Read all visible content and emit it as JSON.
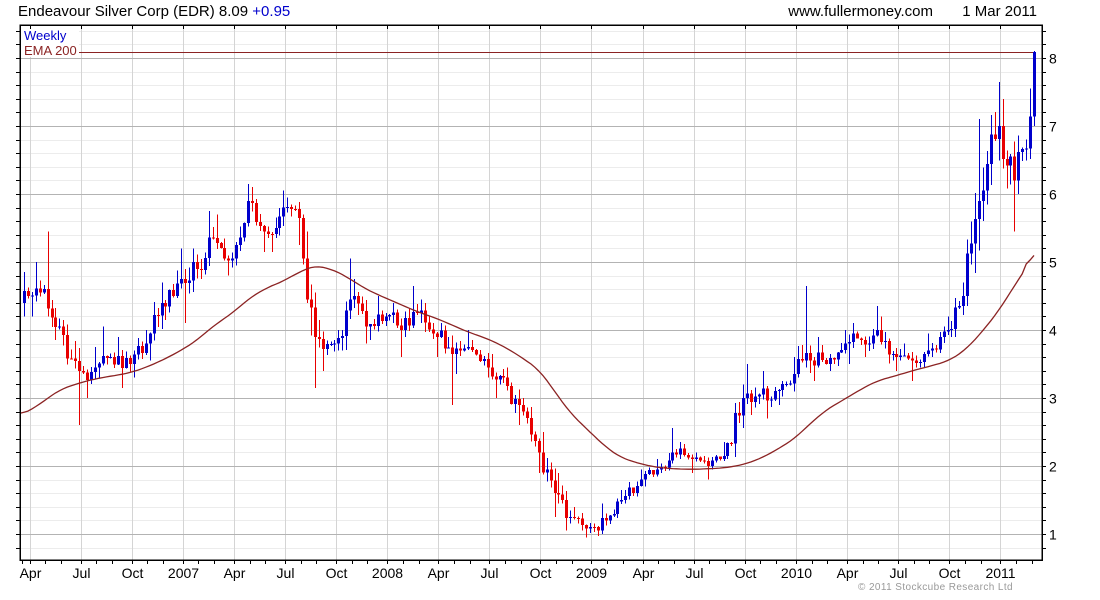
{
  "header": {
    "title": "Endeavour Silver Corp (EDR)",
    "last_price": "8.09",
    "change": "+0.95",
    "source": "www.fullermoney.com",
    "date": "1 Mar 2011"
  },
  "legend": {
    "period": "Weekly",
    "overlay": "EMA 200"
  },
  "footer": {
    "copyright": "© 2011 Stockcube Research Ltd"
  },
  "colors": {
    "up": "#0000cc",
    "down": "#e80000",
    "ema": "#8b2323",
    "last_price_line": "#8b2323",
    "grid_major": "#b3b3b3",
    "grid_minor": "#ececec",
    "grid_vertical": "#d4d4d4",
    "axis": "#000000",
    "change_text": "#0000cc",
    "copyright_text": "#999999"
  },
  "chart_data": {
    "type": "candlestick",
    "period": "weekly",
    "title": "Endeavour Silver Corp (EDR)",
    "last_close": 8.09,
    "change": 0.95,
    "previous_close": 7.14,
    "overlay": "EMA 200",
    "ylim": [
      0.62,
      8.49
    ],
    "y_ticks": [
      1,
      2,
      3,
      4,
      5,
      6,
      7,
      8
    ],
    "y_minor_step": 0.2,
    "x_quarter_labels": [
      "Apr",
      "Jul",
      "Oct",
      "2007",
      "Apr",
      "Jul",
      "Oct",
      "2008",
      "Apr",
      "Jul",
      "Oct",
      "2009",
      "Apr",
      "Jul",
      "Oct",
      "2010",
      "Apr",
      "Jul",
      "Oct",
      "2011"
    ],
    "month_names": {
      "4": "Apr",
      "7": "Jul",
      "10": "Oct"
    },
    "start_price": 4.4,
    "ema_start": 2.75,
    "months": [
      {
        "m": "2006-03",
        "w": 2,
        "c": 4.5,
        "h": 4.85,
        "l": 4.2,
        "ema": 2.8
      },
      {
        "m": "2006-04",
        "w": 4,
        "c": 4.6,
        "h": 5.0,
        "l": 4.2,
        "ema": 2.95
      },
      {
        "m": "2006-05",
        "w": 4,
        "c": 4.05,
        "h": 5.45,
        "l": 3.85,
        "ema": 3.12
      },
      {
        "m": "2006-06",
        "w": 5,
        "c": 3.4,
        "h": 4.15,
        "l": 2.6,
        "ema": 3.22
      },
      {
        "m": "2006-07",
        "w": 4,
        "c": 3.45,
        "h": 3.75,
        "l": 3.0,
        "ema": 3.28
      },
      {
        "m": "2006-08",
        "w": 4,
        "c": 3.6,
        "h": 4.05,
        "l": 3.3,
        "ema": 3.32
      },
      {
        "m": "2006-09",
        "w": 5,
        "c": 3.5,
        "h": 3.9,
        "l": 3.15,
        "ema": 3.37
      },
      {
        "m": "2006-10",
        "w": 4,
        "c": 3.8,
        "h": 4.0,
        "l": 3.3,
        "ema": 3.45
      },
      {
        "m": "2006-11",
        "w": 4,
        "c": 4.4,
        "h": 4.7,
        "l": 3.55,
        "ema": 3.55
      },
      {
        "m": "2006-12",
        "w": 5,
        "c": 4.75,
        "h": 5.2,
        "l": 4.15,
        "ema": 3.7
      },
      {
        "m": "2007-01",
        "w": 4,
        "c": 4.9,
        "h": 5.2,
        "l": 4.1,
        "ema": 3.85
      },
      {
        "m": "2007-02",
        "w": 4,
        "c": 5.35,
        "h": 5.75,
        "l": 4.75,
        "ema": 4.05
      },
      {
        "m": "2007-03",
        "w": 5,
        "c": 5.05,
        "h": 5.7,
        "l": 4.8,
        "ema": 4.25
      },
      {
        "m": "2007-04",
        "w": 4,
        "c": 5.9,
        "h": 6.15,
        "l": 4.95,
        "ema": 4.45
      },
      {
        "m": "2007-05",
        "w": 4,
        "c": 5.45,
        "h": 6.1,
        "l": 5.15,
        "ema": 4.6
      },
      {
        "m": "2007-06",
        "w": 5,
        "c": 5.8,
        "h": 6.05,
        "l": 5.15,
        "ema": 4.72
      },
      {
        "m": "2007-07",
        "w": 4,
        "c": 5.65,
        "h": 5.95,
        "l": 5.25,
        "ema": 4.85
      },
      {
        "m": "2007-08",
        "w": 4,
        "c": 3.9,
        "h": 5.7,
        "l": 3.15,
        "ema": 4.95
      },
      {
        "m": "2007-09",
        "w": 5,
        "c": 3.8,
        "h": 4.15,
        "l": 3.4,
        "ema": 4.88
      },
      {
        "m": "2007-10",
        "w": 4,
        "c": 4.45,
        "h": 5.05,
        "l": 3.7,
        "ema": 4.75
      },
      {
        "m": "2007-11",
        "w": 4,
        "c": 4.05,
        "h": 4.75,
        "l": 3.8,
        "ema": 4.6
      },
      {
        "m": "2007-12",
        "w": 5,
        "c": 4.2,
        "h": 4.5,
        "l": 3.85,
        "ema": 4.47
      },
      {
        "m": "2008-01",
        "w": 4,
        "c": 4.0,
        "h": 4.4,
        "l": 3.6,
        "ema": 4.37
      },
      {
        "m": "2008-02",
        "w": 4,
        "c": 4.25,
        "h": 4.65,
        "l": 3.9,
        "ema": 4.27
      },
      {
        "m": "2008-03",
        "w": 5,
        "c": 3.9,
        "h": 4.45,
        "l": 3.6,
        "ema": 4.17
      },
      {
        "m": "2008-04",
        "w": 4,
        "c": 3.65,
        "h": 4.1,
        "l": 2.9,
        "ema": 4.07
      },
      {
        "m": "2008-05",
        "w": 4,
        "c": 3.75,
        "h": 4.0,
        "l": 3.35,
        "ema": 3.97
      },
      {
        "m": "2008-06",
        "w": 5,
        "c": 3.45,
        "h": 3.85,
        "l": 3.3,
        "ema": 3.87
      },
      {
        "m": "2008-07",
        "w": 4,
        "c": 3.3,
        "h": 3.65,
        "l": 3.0,
        "ema": 3.76
      },
      {
        "m": "2008-08",
        "w": 4,
        "c": 2.9,
        "h": 3.45,
        "l": 2.6,
        "ema": 3.62
      },
      {
        "m": "2008-09",
        "w": 5,
        "c": 2.2,
        "h": 3.0,
        "l": 1.9,
        "ema": 3.42
      },
      {
        "m": "2008-10",
        "w": 4,
        "c": 1.6,
        "h": 2.5,
        "l": 1.25,
        "ema": 3.1
      },
      {
        "m": "2008-11",
        "w": 4,
        "c": 1.25,
        "h": 1.9,
        "l": 1.05,
        "ema": 2.78
      },
      {
        "m": "2008-12",
        "w": 5,
        "c": 1.1,
        "h": 1.4,
        "l": 0.95,
        "ema": 2.5
      },
      {
        "m": "2009-01",
        "w": 4,
        "c": 1.2,
        "h": 1.45,
        "l": 0.97,
        "ema": 2.28
      },
      {
        "m": "2009-02",
        "w": 4,
        "c": 1.5,
        "h": 1.65,
        "l": 1.15,
        "ema": 2.12
      },
      {
        "m": "2009-03",
        "w": 5,
        "c": 1.8,
        "h": 1.95,
        "l": 1.45,
        "ema": 2.03
      },
      {
        "m": "2009-04",
        "w": 4,
        "c": 1.95,
        "h": 2.1,
        "l": 1.7,
        "ema": 1.98
      },
      {
        "m": "2009-05",
        "w": 4,
        "c": 2.2,
        "h": 2.56,
        "l": 1.9,
        "ema": 1.96
      },
      {
        "m": "2009-06",
        "w": 5,
        "c": 2.1,
        "h": 2.35,
        "l": 1.9,
        "ema": 1.95
      },
      {
        "m": "2009-07",
        "w": 4,
        "c": 2.0,
        "h": 2.2,
        "l": 1.8,
        "ema": 1.96
      },
      {
        "m": "2009-08",
        "w": 4,
        "c": 2.15,
        "h": 2.35,
        "l": 1.95,
        "ema": 1.97
      },
      {
        "m": "2009-09",
        "w": 5,
        "c": 3.0,
        "h": 3.2,
        "l": 2.1,
        "ema": 2.02
      },
      {
        "m": "2009-10",
        "w": 4,
        "c": 3.05,
        "h": 3.5,
        "l": 2.75,
        "ema": 2.1
      },
      {
        "m": "2009-11",
        "w": 4,
        "c": 3.1,
        "h": 3.4,
        "l": 2.7,
        "ema": 2.22
      },
      {
        "m": "2009-12",
        "w": 5,
        "c": 3.35,
        "h": 3.6,
        "l": 2.9,
        "ema": 2.4
      },
      {
        "m": "2010-01",
        "w": 4,
        "c": 3.55,
        "h": 4.65,
        "l": 3.3,
        "ema": 2.62
      },
      {
        "m": "2010-02",
        "w": 4,
        "c": 3.5,
        "h": 3.9,
        "l": 3.25,
        "ema": 2.82
      },
      {
        "m": "2010-03",
        "w": 5,
        "c": 3.8,
        "h": 4.0,
        "l": 3.4,
        "ema": 2.99
      },
      {
        "m": "2010-04",
        "w": 4,
        "c": 3.85,
        "h": 4.1,
        "l": 3.5,
        "ema": 3.13
      },
      {
        "m": "2010-05",
        "w": 4,
        "c": 4.0,
        "h": 4.35,
        "l": 3.6,
        "ema": 3.25
      },
      {
        "m": "2010-06",
        "w": 5,
        "c": 3.6,
        "h": 4.2,
        "l": 3.4,
        "ema": 3.33
      },
      {
        "m": "2010-07",
        "w": 4,
        "c": 3.55,
        "h": 3.8,
        "l": 3.25,
        "ema": 3.4
      },
      {
        "m": "2010-08",
        "w": 4,
        "c": 3.7,
        "h": 3.95,
        "l": 3.45,
        "ema": 3.46
      },
      {
        "m": "2010-09",
        "w": 5,
        "c": 4.0,
        "h": 4.2,
        "l": 3.6,
        "ema": 3.54
      },
      {
        "m": "2010-10",
        "w": 4,
        "c": 4.5,
        "h": 4.7,
        "l": 3.9,
        "ema": 3.68
      },
      {
        "m": "2010-11",
        "w": 4,
        "c": 5.9,
        "h": 7.1,
        "l": 4.35,
        "ema": 3.92
      },
      {
        "m": "2010-12",
        "w": 5,
        "c": 7.0,
        "h": 7.65,
        "l": 5.6,
        "ema": 4.28
      },
      {
        "m": "2011-01",
        "w": 4,
        "c": 6.2,
        "h": 7.4,
        "l": 5.45,
        "ema": 4.65
      },
      {
        "m": "2011-02",
        "w": 4,
        "c": 7.14,
        "h": 7.55,
        "l": 6.0,
        "ema": 5.0
      },
      {
        "m": "2011-03",
        "w": 1,
        "c": 8.09,
        "h": 8.1,
        "l": 7.0,
        "ema": 5.38
      }
    ]
  }
}
